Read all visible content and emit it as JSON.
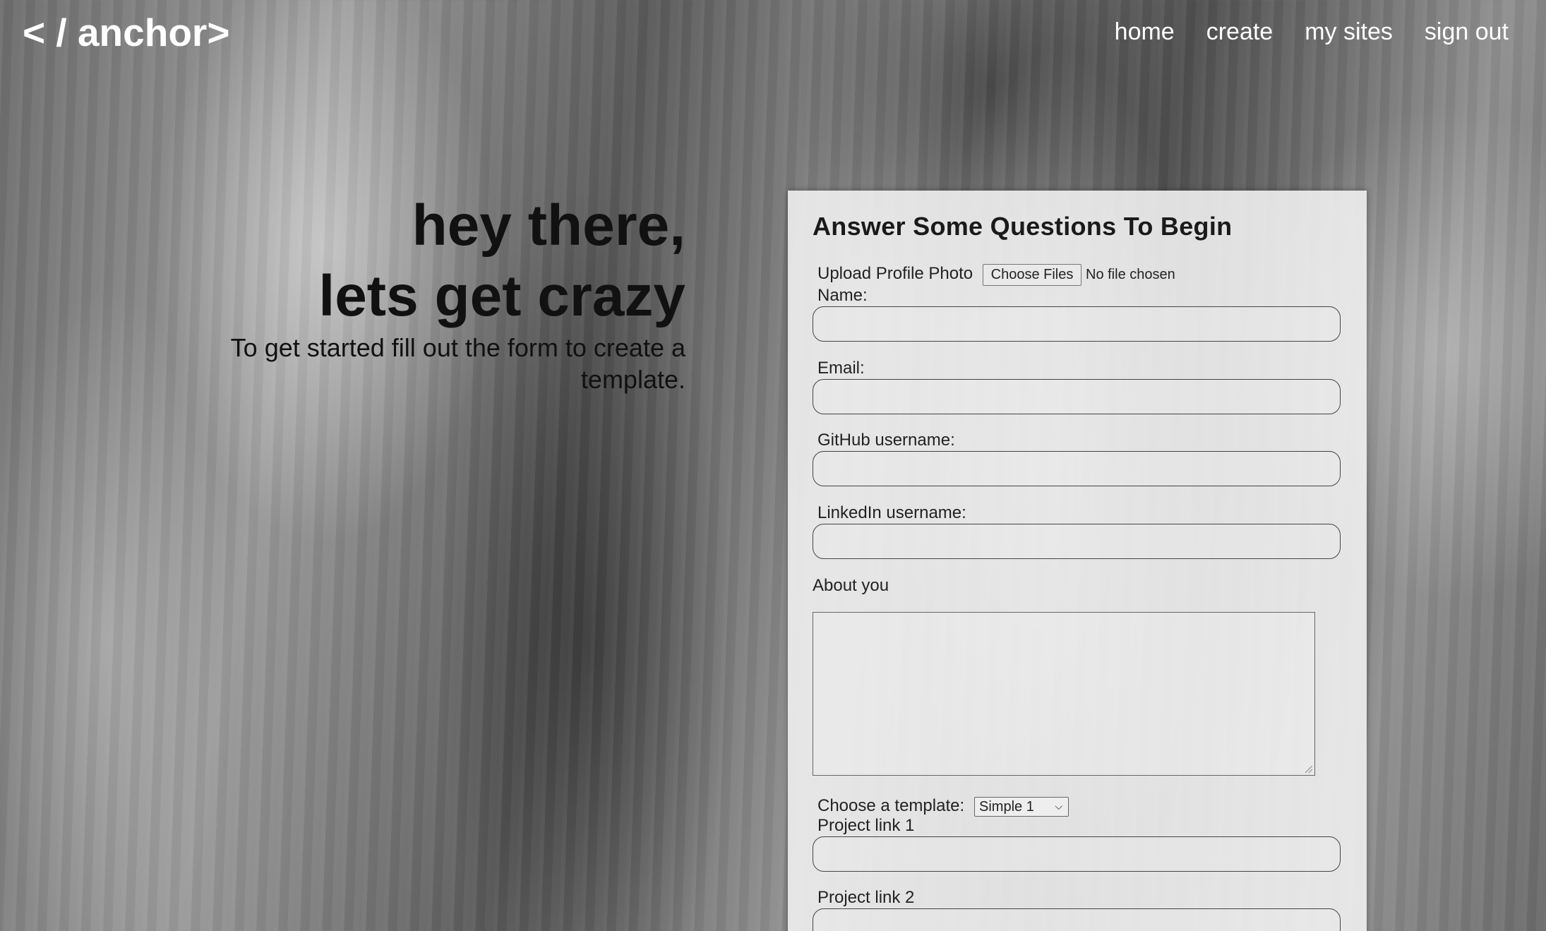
{
  "header": {
    "logo": "< / anchor>",
    "nav": [
      "home",
      "create",
      "my sites",
      "sign out"
    ]
  },
  "hero": {
    "line1": "hey there,",
    "line2": "lets get crazy",
    "subtitle": "To get started fill out the form to create a template."
  },
  "form": {
    "title": "Answer Some Questions To Begin",
    "photo_label": "Upload Profile Photo",
    "file_button": "Choose Files",
    "file_status": "No file chosen",
    "name_label": "Name:",
    "email_label": "Email:",
    "github_label": "GitHub username:",
    "linkedin_label": "LinkedIn username:",
    "about_label": "About you",
    "template_label": "Choose a template:",
    "template_selected": "Simple 1",
    "project1_label": "Project link 1",
    "project2_label": "Project link 2"
  },
  "colors": {
    "nav_text": "#ffffff",
    "hero_text": "#111111",
    "card_bg": "#f0f0f0"
  }
}
